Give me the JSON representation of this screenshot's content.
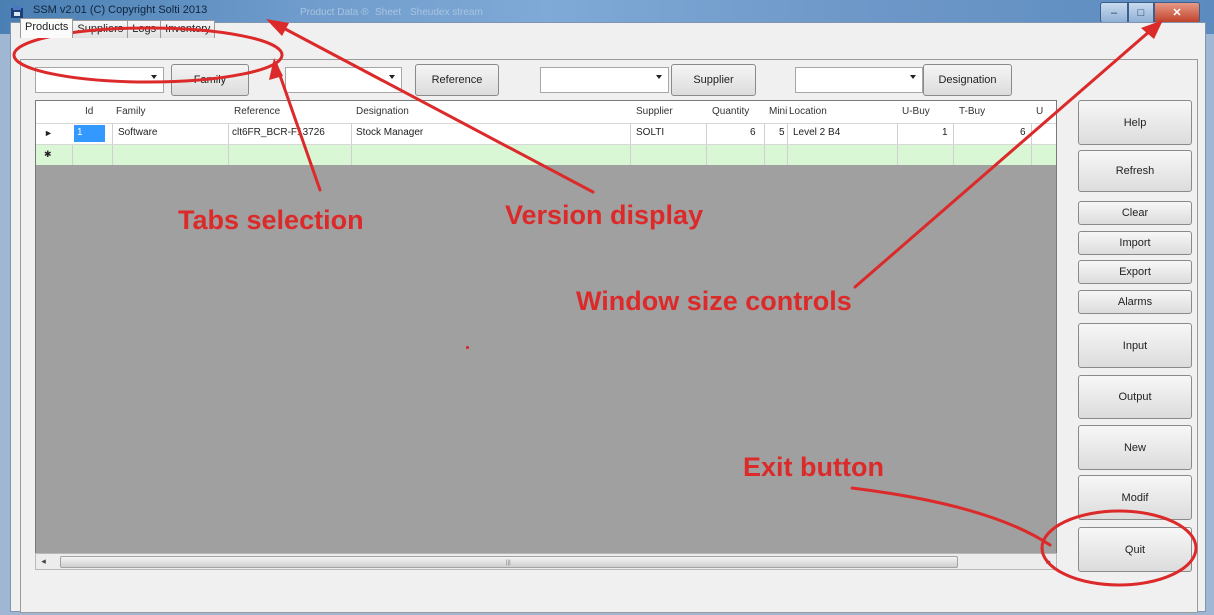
{
  "window": {
    "title": "SSM v2.01 (C) Copyright Solti 2013",
    "ghost_taskbar": [
      "Product Data ®",
      "Sheet",
      "Sheudex stream"
    ],
    "controls": {
      "minimize": "–",
      "maximize": "□",
      "close": "✕"
    }
  },
  "tabs": [
    {
      "label": "Products",
      "active": true
    },
    {
      "label": "Suppliers",
      "active": false
    },
    {
      "label": "Logs",
      "active": false
    },
    {
      "label": "Inventory",
      "active": false
    }
  ],
  "filters": {
    "family_button": "Family",
    "reference_button": "Reference",
    "supplier_button": "Supplier",
    "designation_button": "Designation"
  },
  "grid": {
    "columns": [
      "Id",
      "Family",
      "Reference",
      "Designation",
      "Supplier",
      "Quantity",
      "Mini",
      "Location",
      "U-Buy",
      "T-Buy",
      "U"
    ],
    "rows": [
      {
        "indicator": "►",
        "id": "1",
        "family": "Software",
        "reference": "clt6FR_BCR-F13726",
        "designation": "Stock Manager",
        "supplier": "SOLTI",
        "quantity": "6",
        "mini": "5",
        "location": "Level 2 B4",
        "ubuy": "1",
        "tbuy": "6"
      }
    ],
    "new_row_indicator": "✱"
  },
  "side_buttons": {
    "help": "Help",
    "refresh": "Refresh",
    "clear": "Clear",
    "import": "Import",
    "export": "Export",
    "alarms": "Alarms",
    "input": "Input",
    "output": "Output",
    "new": "New",
    "modif": "Modif",
    "quit": "Quit"
  },
  "annotations": {
    "tabs_selection": "Tabs selection",
    "version_display": "Version display",
    "window_size_controls": "Window size controls",
    "exit_button": "Exit button",
    "color": "#dc2a2a"
  }
}
